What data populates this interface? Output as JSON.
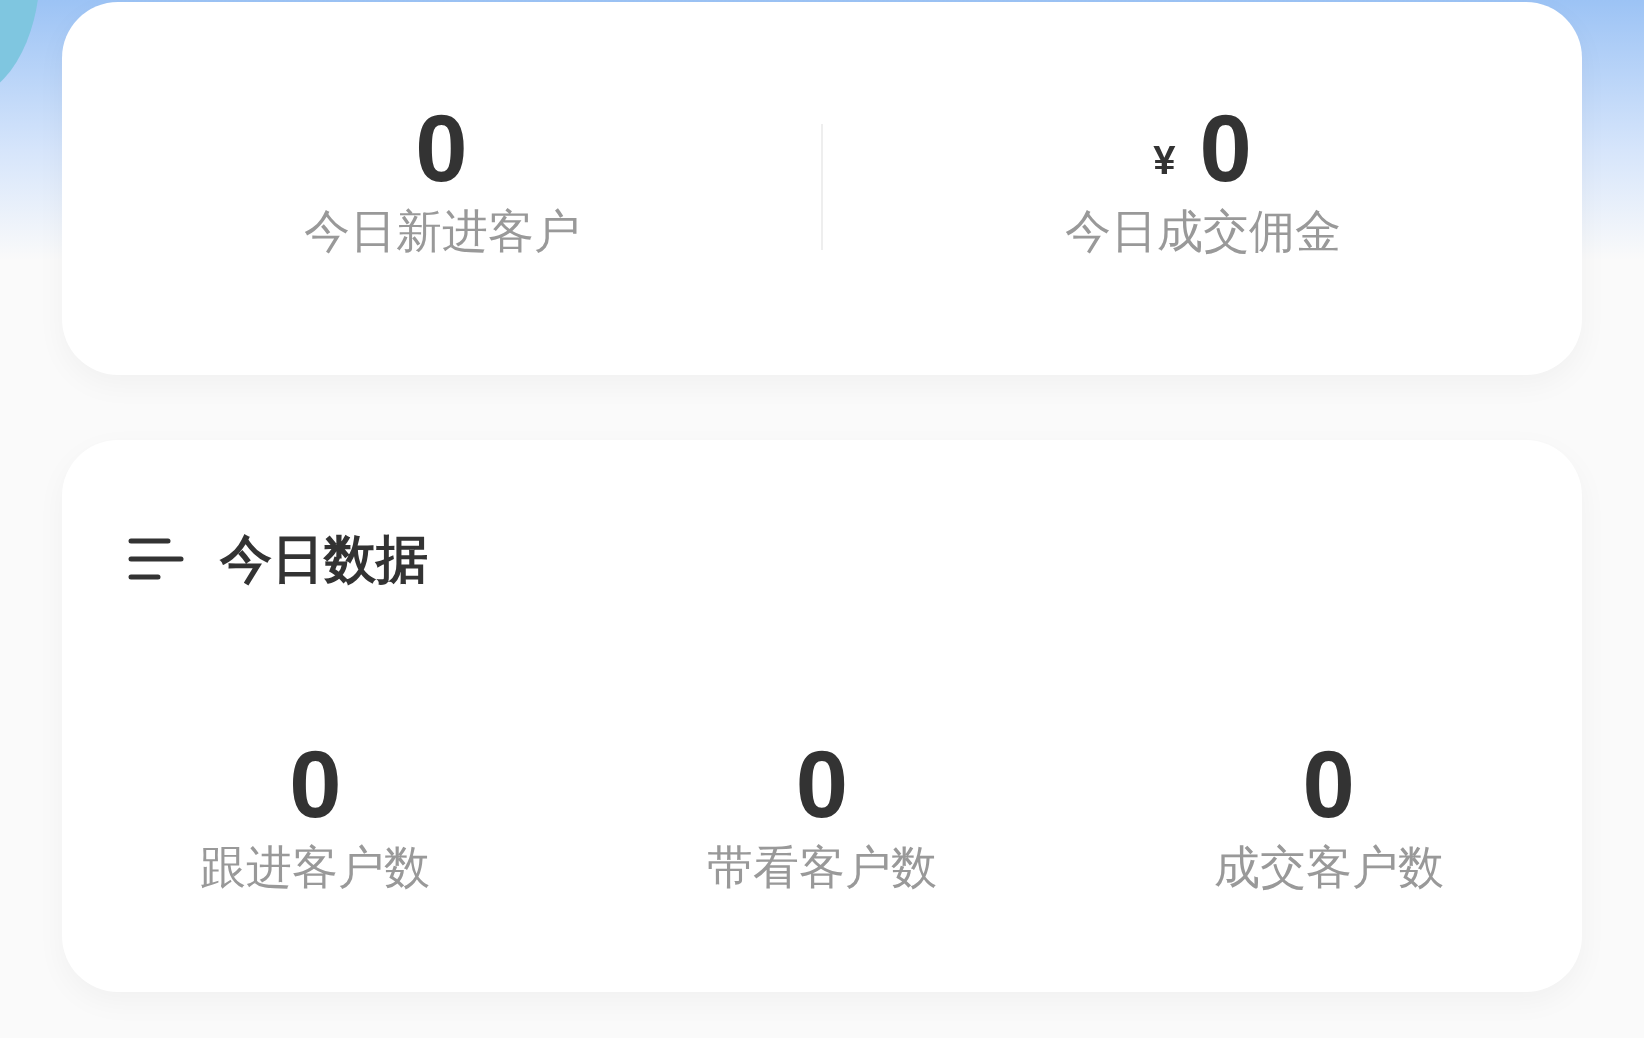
{
  "summary": [
    {
      "value": "0",
      "label": "今日新进客户"
    },
    {
      "currency": "¥",
      "value": "0",
      "label": "今日成交佣金"
    }
  ],
  "today": {
    "title": "今日数据",
    "stats": [
      {
        "value": "0",
        "label": "跟进客户数"
      },
      {
        "value": "0",
        "label": "带看客户数"
      },
      {
        "value": "0",
        "label": "成交客户数"
      }
    ]
  }
}
